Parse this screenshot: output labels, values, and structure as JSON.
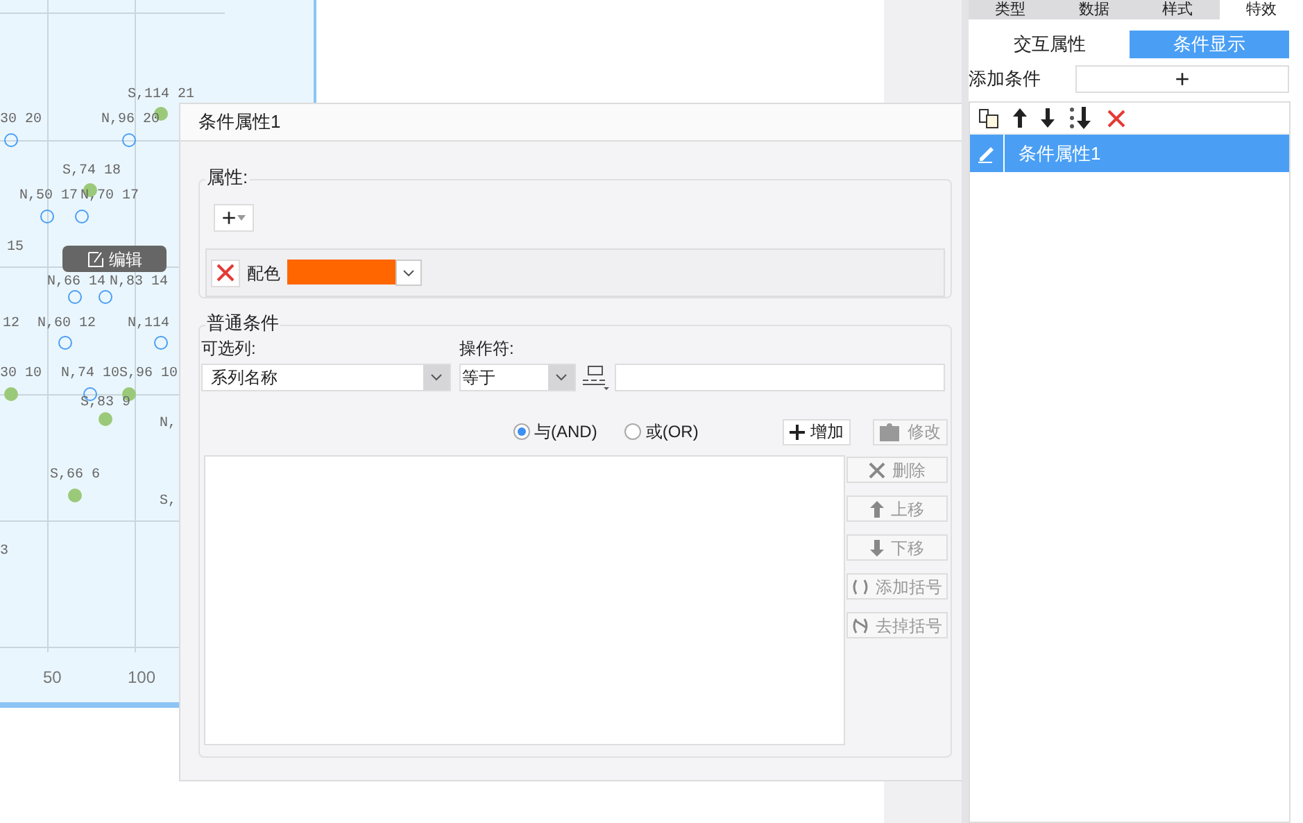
{
  "chart": {
    "edit_button": "编辑",
    "x_ticks": [
      "50",
      "100"
    ],
    "point_labels": [
      {
        "text": "S,114 21",
        "kind": "filled"
      },
      {
        "text": "30 20",
        "kind": "hollow"
      },
      {
        "text": "N,96 20",
        "kind": "hollow"
      },
      {
        "text": "S,74 18",
        "kind": "filled"
      },
      {
        "text": "N,50 17",
        "kind": "hollow"
      },
      {
        "text": "N,70 17",
        "kind": "hollow"
      },
      {
        "text": "15",
        "kind": "label"
      },
      {
        "text": "N,66 14",
        "kind": "hollow"
      },
      {
        "text": "N,83 14",
        "kind": "hollow"
      },
      {
        "text": "12",
        "kind": "label"
      },
      {
        "text": "N,60 12",
        "kind": "hollow"
      },
      {
        "text": "N,114",
        "kind": "hollow"
      },
      {
        "text": "30 10",
        "kind": "filled"
      },
      {
        "text": "N,74 10",
        "kind": "hollow"
      },
      {
        "text": "S,96 10",
        "kind": "filled"
      },
      {
        "text": "S,83 9",
        "kind": "filled"
      },
      {
        "text": "N,",
        "kind": "label"
      },
      {
        "text": "S,66 6",
        "kind": "filled"
      },
      {
        "text": "S,",
        "kind": "label"
      },
      {
        "text": "3",
        "kind": "label"
      }
    ]
  },
  "dialog": {
    "title": "条件属性1",
    "attributes": {
      "legend": "属性:",
      "add_button": "+",
      "rows": [
        {
          "label": "配色",
          "color": "#ff6600"
        }
      ]
    },
    "conditions": {
      "legend": "普通条件",
      "column_label": "可选列:",
      "column_value": "系列名称",
      "operator_label": "操作符:",
      "operator_value": "等于",
      "logic": [
        {
          "label": "与(AND)",
          "selected": true
        },
        {
          "label": "或(OR)",
          "selected": false
        }
      ],
      "add_button": {
        "label": "增加",
        "disabled": false
      },
      "modify_button": {
        "label": "修改",
        "disabled": true
      },
      "side_buttons": [
        {
          "label": "删除",
          "kind": "delete",
          "disabled": true
        },
        {
          "label": "上移",
          "kind": "up",
          "disabled": true
        },
        {
          "label": "下移",
          "kind": "down",
          "disabled": true
        },
        {
          "label": "添加括号",
          "kind": "paren",
          "disabled": true
        },
        {
          "label": "去掉括号",
          "kind": "unparen",
          "disabled": true
        }
      ]
    }
  },
  "right_panel": {
    "tabs": [
      {
        "label": "类型",
        "selected": false
      },
      {
        "label": "数据",
        "selected": false
      },
      {
        "label": "样式",
        "selected": false
      },
      {
        "label": "特效",
        "selected": true
      }
    ],
    "sub_tabs": [
      {
        "label": "交互属性",
        "selected": false
      },
      {
        "label": "条件显示",
        "selected": true
      }
    ],
    "add_condition_label": "添加条件",
    "add_condition_button": "+",
    "conditions": [
      {
        "label": "条件属性1",
        "selected": true
      }
    ]
  }
}
